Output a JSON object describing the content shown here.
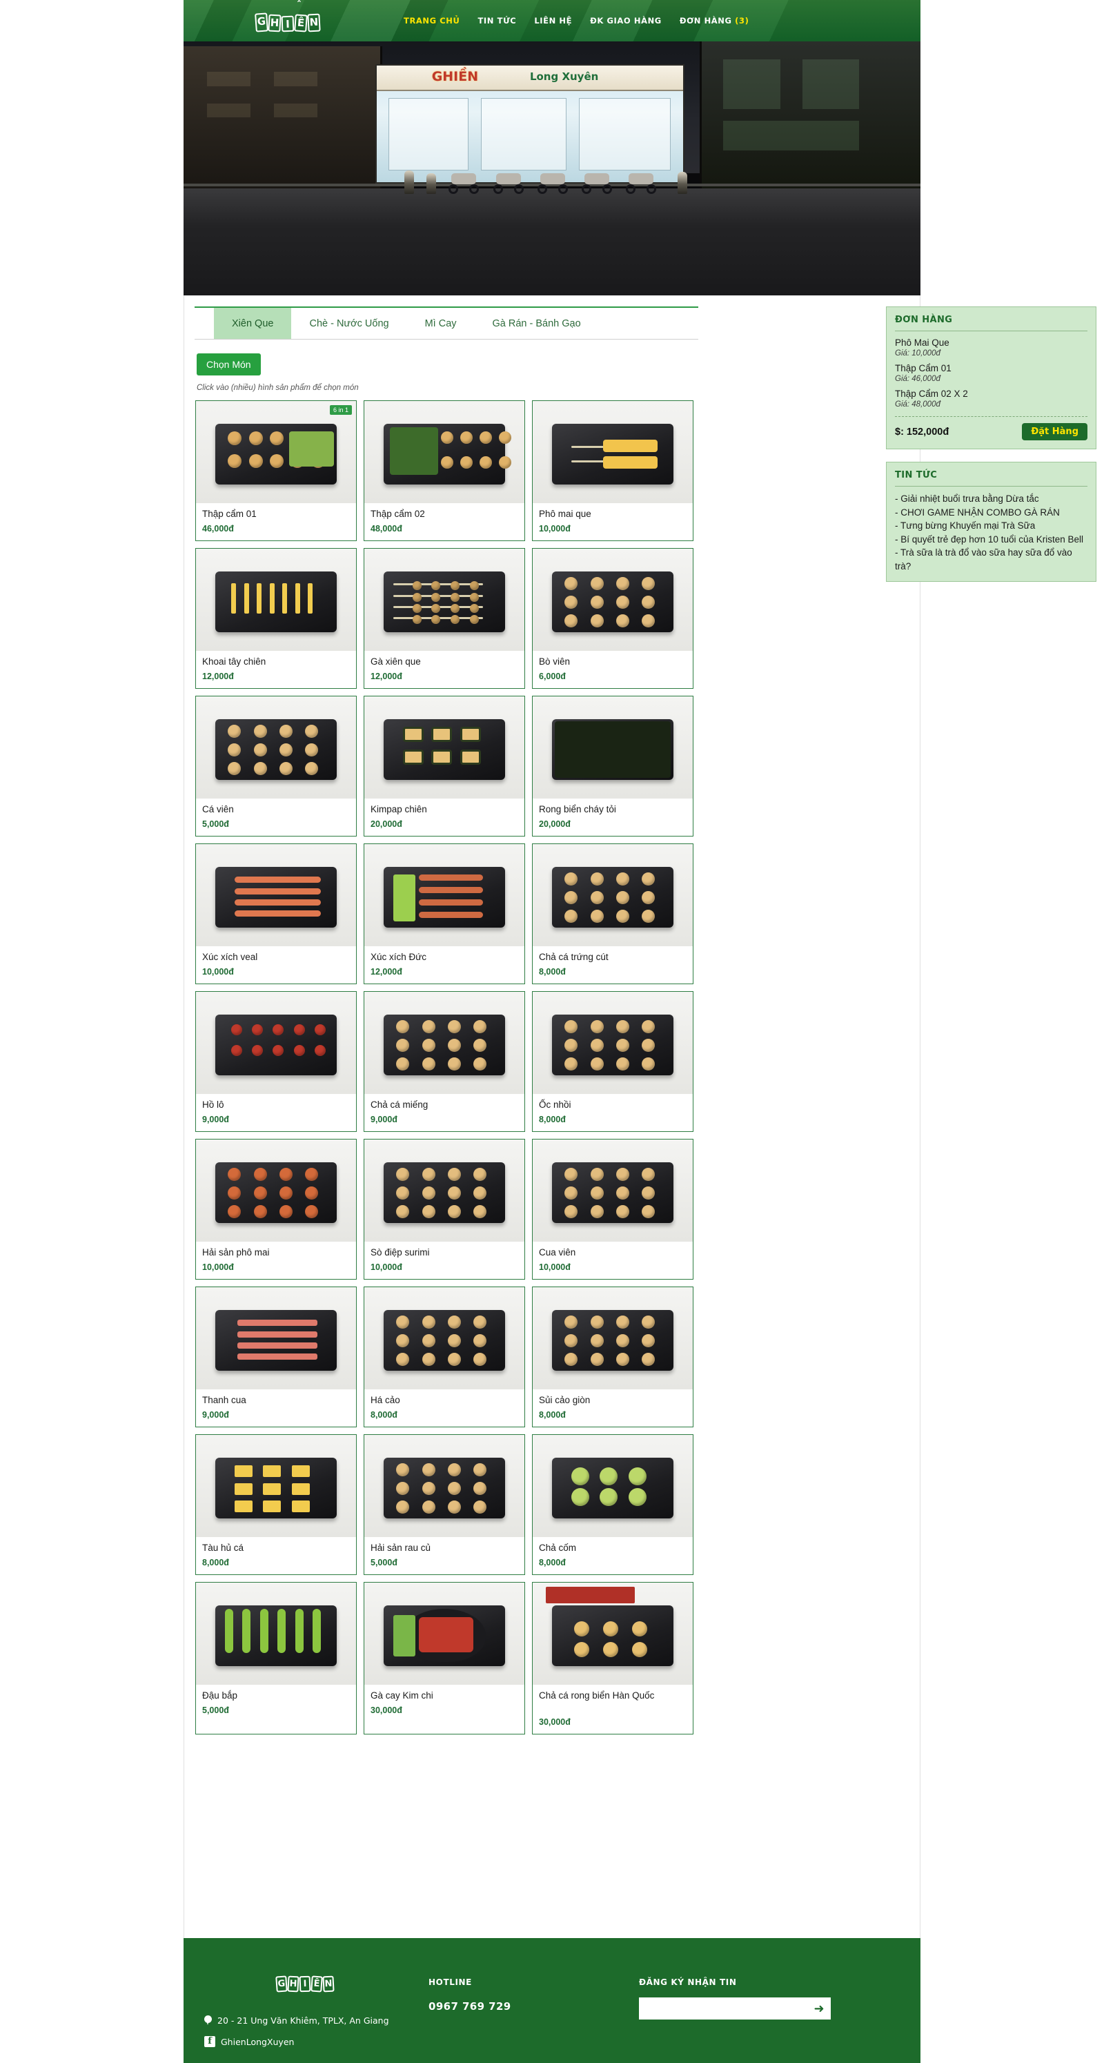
{
  "site": {
    "brand": "GHIỀN",
    "accent_green": "#1d6b2b",
    "accent_yellow": "#ffe400",
    "tab_active_bg": "#b6dfb8"
  },
  "header": {
    "nav": [
      {
        "label": "TRANG CHỦ",
        "active": true
      },
      {
        "label": "TIN TỨC",
        "active": false
      },
      {
        "label": "LIÊN HỆ",
        "active": false
      },
      {
        "label": "ĐK GIAO HÀNG",
        "active": false
      },
      {
        "label": "ĐƠN HÀNG",
        "active": false
      }
    ],
    "cart_count": "(3)"
  },
  "banner": {
    "shop_sign_main": "GHIỀN",
    "shop_sign_sub": "Long Xuyên"
  },
  "tabs": [
    {
      "label": "Xiên Que",
      "active": true
    },
    {
      "label": "Chè - Nước Uống",
      "active": false
    },
    {
      "label": "Mì Cay",
      "active": false
    },
    {
      "label": "Gà Rán - Bánh Gạo",
      "active": false
    }
  ],
  "toolbar": {
    "choose_label": "Chọn Món",
    "hint": "Click vào (nhiều) hình sản phẩm để chọn món"
  },
  "products": [
    {
      "name": "Thập cẩm 01",
      "price": "46,000đ",
      "badge": "6 in 1",
      "style": "mixed"
    },
    {
      "name": "Thập cẩm 02",
      "price": "48,000đ",
      "style": "mixed2"
    },
    {
      "name": "Phô mai que",
      "price": "10,000đ",
      "style": "cheese"
    },
    {
      "name": "Khoai tây chiên",
      "price": "12,000đ",
      "style": "fries"
    },
    {
      "name": "Gà xiên que",
      "price": "12,000đ",
      "style": "skewer"
    },
    {
      "name": "Bò viên",
      "price": "6,000đ",
      "style": "balls"
    },
    {
      "name": "Cá viên",
      "price": "5,000đ",
      "style": "balls"
    },
    {
      "name": "Kimpap chiên",
      "price": "20,000đ",
      "style": "kimpap"
    },
    {
      "name": "Rong biển cháy tỏi",
      "price": "20,000đ",
      "style": "seaweed"
    },
    {
      "name": "Xúc xích veal",
      "price": "10,000đ",
      "style": "sausage"
    },
    {
      "name": "Xúc xích Đức",
      "price": "12,000đ",
      "style": "sausage2"
    },
    {
      "name": "Chả cá trứng cút",
      "price": "8,000đ",
      "style": "balls"
    },
    {
      "name": "Hồ lô",
      "price": "9,000đ",
      "style": "hollo"
    },
    {
      "name": "Chả cá miếng",
      "price": "9,000đ",
      "style": "balls"
    },
    {
      "name": "Ốc nhồi",
      "price": "8,000đ",
      "style": "balls"
    },
    {
      "name": "Hải sản phô mai",
      "price": "10,000đ",
      "style": "redballs"
    },
    {
      "name": "Sò điệp surimi",
      "price": "10,000đ",
      "style": "balls"
    },
    {
      "name": "Cua viên",
      "price": "10,000đ",
      "style": "balls"
    },
    {
      "name": "Thanh cua",
      "price": "9,000đ",
      "style": "crabstick"
    },
    {
      "name": "Há cảo",
      "price": "8,000đ",
      "style": "balls"
    },
    {
      "name": "Sủi cảo giòn",
      "price": "8,000đ",
      "style": "balls"
    },
    {
      "name": "Tàu hủ cá",
      "price": "8,000đ",
      "style": "tofu"
    },
    {
      "name": "Hải sản rau củ",
      "price": "5,000đ",
      "style": "balls"
    },
    {
      "name": "Chả cốm",
      "price": "8,000đ",
      "style": "green"
    },
    {
      "name": "Đậu bắp",
      "price": "5,000đ",
      "style": "okra"
    },
    {
      "name": "Gà cay Kim chi",
      "price": "30,000đ",
      "style": "spicy"
    },
    {
      "name": "Chả cá rong biển Hàn Quốc",
      "price": "30,000đ",
      "style": "korean"
    }
  ],
  "order_panel": {
    "title": "ĐƠN HÀNG",
    "items": [
      {
        "name": "Phô Mai Que",
        "price": "Giá: 10,000đ"
      },
      {
        "name": "Thập Cẩm 01",
        "price": "Giá: 46,000đ"
      },
      {
        "name": "Thập Cẩm 02 X 2",
        "price": "Giá: 48,000đ"
      }
    ],
    "total": "$: 152,000đ",
    "submit_label": "Đặt Hàng"
  },
  "news_panel": {
    "title": "TIN TỨC",
    "items": [
      "- Giải nhiệt buổi trưa bằng Dừa tắc",
      "- CHƠI GAME NHẬN COMBO GÀ RÁN",
      "- Tưng bừng Khuyến mại Trà Sữa",
      "- Bí quyết trẻ đẹp hơn 10 tuổi của Kristen Bell",
      "- Trà sữa là trà đổ vào sữa hay sữa đổ vào trà?"
    ]
  },
  "footer": {
    "address": "20 - 21 Ung Văn Khiêm, TPLX, An Giang",
    "facebook": "GhienLongXuyen",
    "hotline_title": "HOTLINE",
    "hotline_number": "0967 769 729",
    "subscribe_title": "ĐĂNG KÝ NHẬN TIN",
    "subscribe_value": "",
    "subscribe_placeholder": "",
    "subscribe_go": "➜"
  }
}
